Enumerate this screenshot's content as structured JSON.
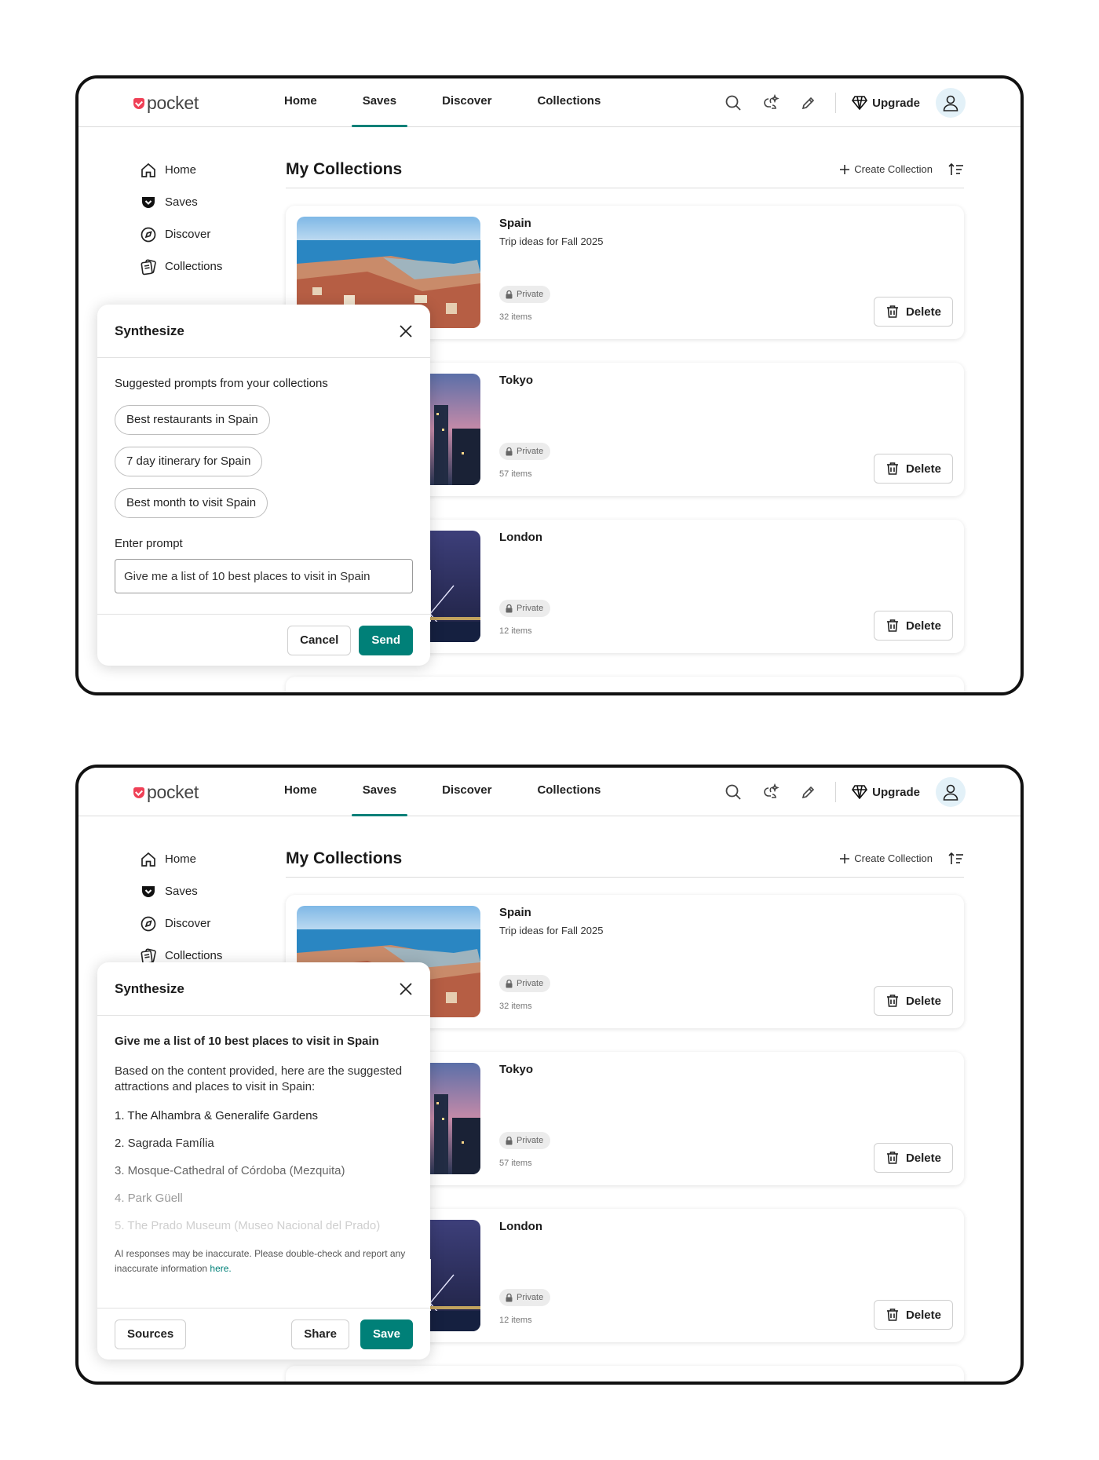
{
  "nav": {
    "logo": "pocket",
    "links": [
      "Home",
      "Saves",
      "Discover",
      "Collections"
    ],
    "active": "Saves",
    "upgrade": "Upgrade",
    "accent": "#008078"
  },
  "sidebar": {
    "items": [
      {
        "label": "Home",
        "icon": "home-icon"
      },
      {
        "label": "Saves",
        "icon": "saves-icon"
      },
      {
        "label": "Discover",
        "icon": "compass-icon"
      },
      {
        "label": "Collections",
        "icon": "collections-icon"
      }
    ]
  },
  "main": {
    "title": "My Collections",
    "create_label": "Create Collection",
    "cards": [
      {
        "title": "Spain",
        "description": "Trip ideas for Fall 2025",
        "badge": "Private",
        "count": "32 items",
        "delete": "Delete"
      },
      {
        "title": "Tokyo",
        "description": "",
        "badge": "Private",
        "count": "57 items",
        "delete": "Delete"
      },
      {
        "title": "London",
        "description": "",
        "badge": "Private",
        "count": "12 items",
        "delete": "Delete"
      }
    ]
  },
  "panel1": {
    "title": "Synthesize",
    "subtitle": "Suggested prompts from your collections",
    "chips": [
      "Best restaurants in Spain",
      "7 day itinerary for Spain",
      "Best month to visit Spain"
    ],
    "prompt_label": "Enter prompt",
    "prompt_value": "Give me a list of 10 best places to visit in Spain",
    "cancel": "Cancel",
    "send": "Send"
  },
  "panel2": {
    "title": "Synthesize",
    "question": "Give me a list of 10 best places to visit in Spain",
    "intro": "Based on the content provided, here are the suggested attractions and places to visit in Spain:",
    "items": [
      "1. The Alhambra & Generalife Gardens",
      "2. Sagrada Família",
      "3. Mosque-Cathedral of Córdoba (Mezquita)",
      "4. Park Güell",
      "5. The Prado Museum (Museo Nacional del Prado)"
    ],
    "disclaimer": "AI responses may be inaccurate. Please double-check and report any inaccurate information",
    "disclaimer_link": "here.",
    "sources": "Sources",
    "share": "Share",
    "save": "Save"
  }
}
